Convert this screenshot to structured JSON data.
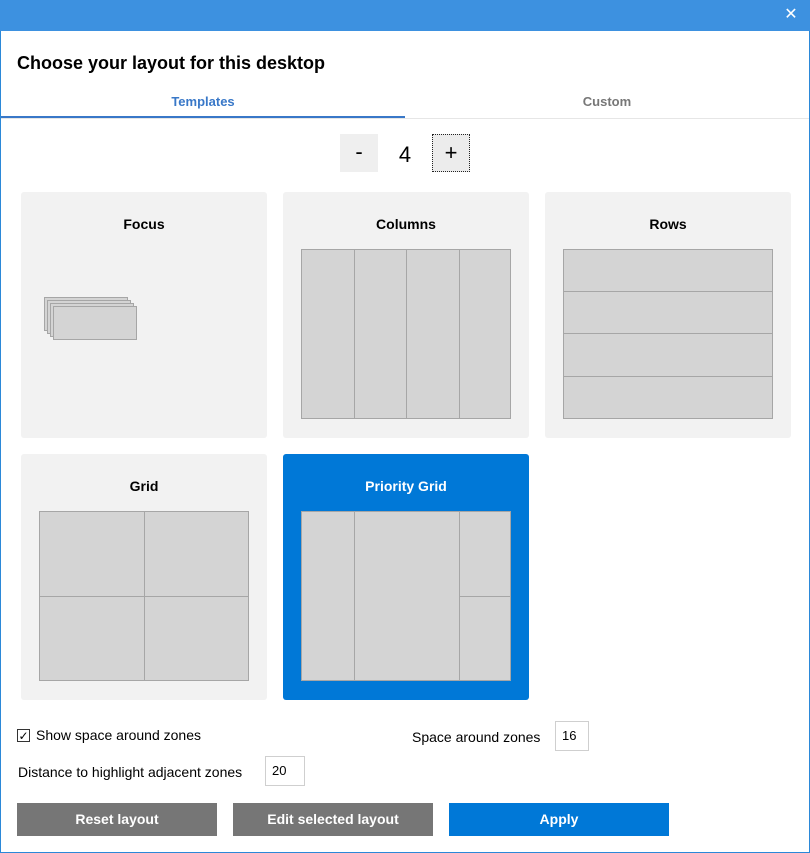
{
  "window": {
    "close_icon": "close-icon"
  },
  "dialog": {
    "heading": "Choose your layout for this desktop"
  },
  "tabs": [
    {
      "label": "Templates",
      "active": true
    },
    {
      "label": "Custom",
      "active": false
    }
  ],
  "zone_count": {
    "minus_label": "-",
    "value": "4",
    "plus_label": "+"
  },
  "templates": [
    {
      "title": "Focus",
      "selected": false
    },
    {
      "title": "Columns",
      "selected": false
    },
    {
      "title": "Rows",
      "selected": false
    },
    {
      "title": "Grid",
      "selected": false
    },
    {
      "title": "Priority Grid",
      "selected": true
    }
  ],
  "settings": {
    "show_space_label": "Show space around zones",
    "show_space_checked": true,
    "space_around_label": "Space around zones",
    "space_around_value": "16",
    "distance_label": "Distance to highlight adjacent zones",
    "distance_value": "20"
  },
  "buttons": {
    "reset": "Reset layout",
    "edit": "Edit selected layout",
    "apply": "Apply"
  },
  "colors": {
    "accent": "#0078d7",
    "titlebar": "#3d91e0",
    "card_bg": "#f2f2f2",
    "zone_fill": "#d4d4d4",
    "zone_border": "#a6a6a6"
  }
}
